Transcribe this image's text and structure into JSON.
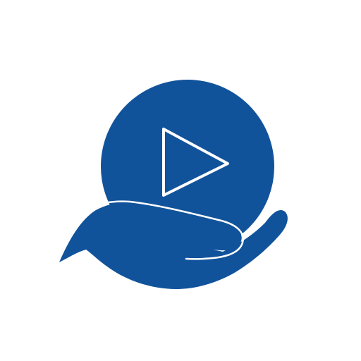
{
  "logo": {
    "icon": "video-play-in-hand-icon",
    "play_icon": "play-triangle-icon",
    "hand_icon": "open-hand-icon",
    "colors": {
      "background": "#ffffff",
      "brand_blue": "#11539b",
      "line": "#ffffff"
    }
  }
}
